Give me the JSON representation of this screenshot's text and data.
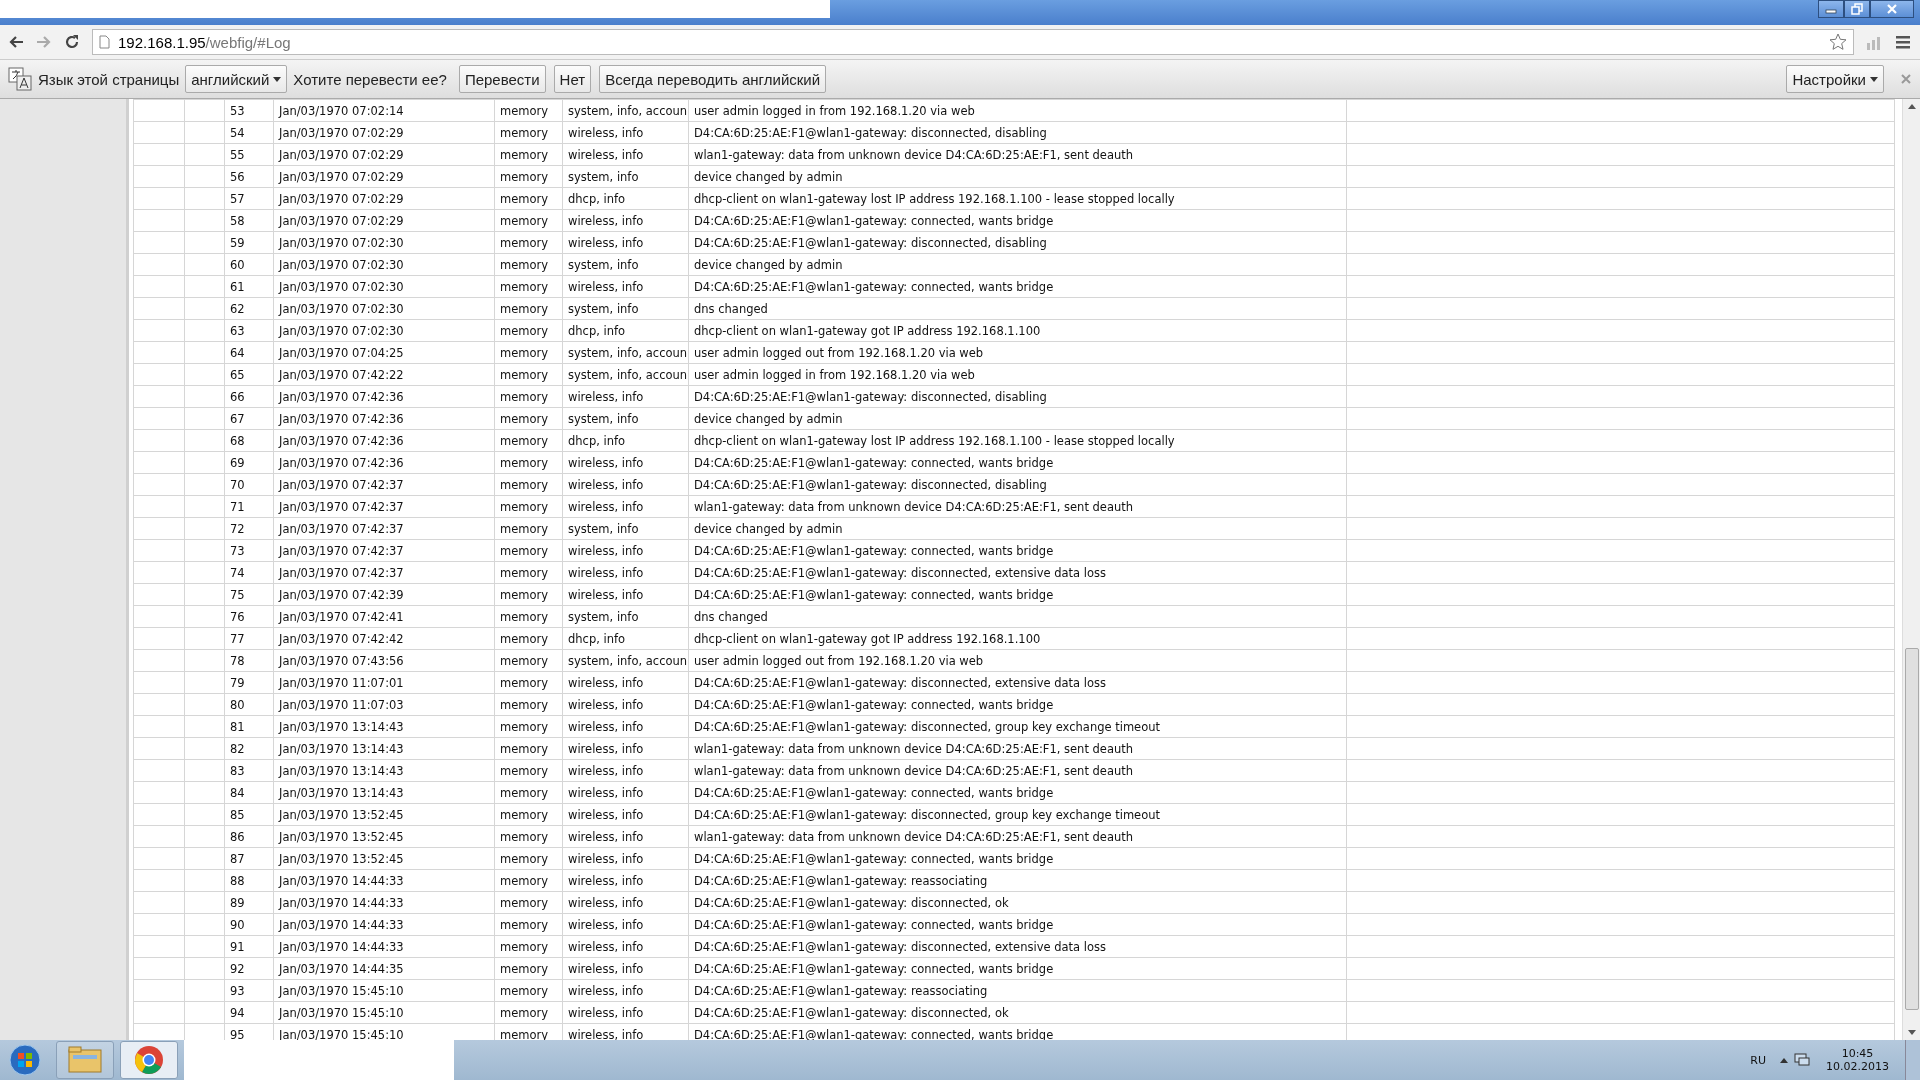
{
  "address_bar": {
    "host": "192.168.1.95",
    "path": "/webfig/#Log"
  },
  "translate_bar": {
    "label": "Язык этой страницы",
    "language": "английский",
    "question": "Хотите перевести ее?",
    "buttons": [
      "Перевести",
      "Нет",
      "Всегда переводить английский"
    ],
    "settings": "Настройки"
  },
  "log": {
    "rows": [
      {
        "number": "53",
        "time": "Jan/03/1970 07:02:14",
        "buffer": "memory",
        "topics": "system, info, accoun",
        "message": "user admin logged in from 192.168.1.20 via web"
      },
      {
        "number": "54",
        "time": "Jan/03/1970 07:02:29",
        "buffer": "memory",
        "topics": "wireless, info",
        "message": "D4:CA:6D:25:AE:F1@wlan1-gateway: disconnected, disabling"
      },
      {
        "number": "55",
        "time": "Jan/03/1970 07:02:29",
        "buffer": "memory",
        "topics": "wireless, info",
        "message": "wlan1-gateway: data from unknown device D4:CA:6D:25:AE:F1, sent deauth"
      },
      {
        "number": "56",
        "time": "Jan/03/1970 07:02:29",
        "buffer": "memory",
        "topics": "system, info",
        "message": "device changed by admin"
      },
      {
        "number": "57",
        "time": "Jan/03/1970 07:02:29",
        "buffer": "memory",
        "topics": "dhcp, info",
        "message": "dhcp-client on wlan1-gateway lost IP address 192.168.1.100 - lease stopped locally"
      },
      {
        "number": "58",
        "time": "Jan/03/1970 07:02:29",
        "buffer": "memory",
        "topics": "wireless, info",
        "message": "D4:CA:6D:25:AE:F1@wlan1-gateway: connected, wants bridge"
      },
      {
        "number": "59",
        "time": "Jan/03/1970 07:02:30",
        "buffer": "memory",
        "topics": "wireless, info",
        "message": "D4:CA:6D:25:AE:F1@wlan1-gateway: disconnected, disabling"
      },
      {
        "number": "60",
        "time": "Jan/03/1970 07:02:30",
        "buffer": "memory",
        "topics": "system, info",
        "message": "device changed by admin"
      },
      {
        "number": "61",
        "time": "Jan/03/1970 07:02:30",
        "buffer": "memory",
        "topics": "wireless, info",
        "message": "D4:CA:6D:25:AE:F1@wlan1-gateway: connected, wants bridge"
      },
      {
        "number": "62",
        "time": "Jan/03/1970 07:02:30",
        "buffer": "memory",
        "topics": "system, info",
        "message": "dns changed"
      },
      {
        "number": "63",
        "time": "Jan/03/1970 07:02:30",
        "buffer": "memory",
        "topics": "dhcp, info",
        "message": "dhcp-client on wlan1-gateway got IP address 192.168.1.100"
      },
      {
        "number": "64",
        "time": "Jan/03/1970 07:04:25",
        "buffer": "memory",
        "topics": "system, info, accoun",
        "message": "user admin logged out from 192.168.1.20 via web"
      },
      {
        "number": "65",
        "time": "Jan/03/1970 07:42:22",
        "buffer": "memory",
        "topics": "system, info, accoun",
        "message": "user admin logged in from 192.168.1.20 via web"
      },
      {
        "number": "66",
        "time": "Jan/03/1970 07:42:36",
        "buffer": "memory",
        "topics": "wireless, info",
        "message": "D4:CA:6D:25:AE:F1@wlan1-gateway: disconnected, disabling"
      },
      {
        "number": "67",
        "time": "Jan/03/1970 07:42:36",
        "buffer": "memory",
        "topics": "system, info",
        "message": "device changed by admin"
      },
      {
        "number": "68",
        "time": "Jan/03/1970 07:42:36",
        "buffer": "memory",
        "topics": "dhcp, info",
        "message": "dhcp-client on wlan1-gateway lost IP address 192.168.1.100 - lease stopped locally"
      },
      {
        "number": "69",
        "time": "Jan/03/1970 07:42:36",
        "buffer": "memory",
        "topics": "wireless, info",
        "message": "D4:CA:6D:25:AE:F1@wlan1-gateway: connected, wants bridge"
      },
      {
        "number": "70",
        "time": "Jan/03/1970 07:42:37",
        "buffer": "memory",
        "topics": "wireless, info",
        "message": "D4:CA:6D:25:AE:F1@wlan1-gateway: disconnected, disabling"
      },
      {
        "number": "71",
        "time": "Jan/03/1970 07:42:37",
        "buffer": "memory",
        "topics": "wireless, info",
        "message": "wlan1-gateway: data from unknown device D4:CA:6D:25:AE:F1, sent deauth"
      },
      {
        "number": "72",
        "time": "Jan/03/1970 07:42:37",
        "buffer": "memory",
        "topics": "system, info",
        "message": "device changed by admin"
      },
      {
        "number": "73",
        "time": "Jan/03/1970 07:42:37",
        "buffer": "memory",
        "topics": "wireless, info",
        "message": "D4:CA:6D:25:AE:F1@wlan1-gateway: connected, wants bridge"
      },
      {
        "number": "74",
        "time": "Jan/03/1970 07:42:37",
        "buffer": "memory",
        "topics": "wireless, info",
        "message": "D4:CA:6D:25:AE:F1@wlan1-gateway: disconnected, extensive data loss"
      },
      {
        "number": "75",
        "time": "Jan/03/1970 07:42:39",
        "buffer": "memory",
        "topics": "wireless, info",
        "message": "D4:CA:6D:25:AE:F1@wlan1-gateway: connected, wants bridge"
      },
      {
        "number": "76",
        "time": "Jan/03/1970 07:42:41",
        "buffer": "memory",
        "topics": "system, info",
        "message": "dns changed"
      },
      {
        "number": "77",
        "time": "Jan/03/1970 07:42:42",
        "buffer": "memory",
        "topics": "dhcp, info",
        "message": "dhcp-client on wlan1-gateway got IP address 192.168.1.100"
      },
      {
        "number": "78",
        "time": "Jan/03/1970 07:43:56",
        "buffer": "memory",
        "topics": "system, info, accoun",
        "message": "user admin logged out from 192.168.1.20 via web"
      },
      {
        "number": "79",
        "time": "Jan/03/1970 11:07:01",
        "buffer": "memory",
        "topics": "wireless, info",
        "message": "D4:CA:6D:25:AE:F1@wlan1-gateway: disconnected, extensive data loss"
      },
      {
        "number": "80",
        "time": "Jan/03/1970 11:07:03",
        "buffer": "memory",
        "topics": "wireless, info",
        "message": "D4:CA:6D:25:AE:F1@wlan1-gateway: connected, wants bridge"
      },
      {
        "number": "81",
        "time": "Jan/03/1970 13:14:43",
        "buffer": "memory",
        "topics": "wireless, info",
        "message": "D4:CA:6D:25:AE:F1@wlan1-gateway: disconnected, group key exchange timeout"
      },
      {
        "number": "82",
        "time": "Jan/03/1970 13:14:43",
        "buffer": "memory",
        "topics": "wireless, info",
        "message": "wlan1-gateway: data from unknown device D4:CA:6D:25:AE:F1, sent deauth"
      },
      {
        "number": "83",
        "time": "Jan/03/1970 13:14:43",
        "buffer": "memory",
        "topics": "wireless, info",
        "message": "wlan1-gateway: data from unknown device D4:CA:6D:25:AE:F1, sent deauth"
      },
      {
        "number": "84",
        "time": "Jan/03/1970 13:14:43",
        "buffer": "memory",
        "topics": "wireless, info",
        "message": "D4:CA:6D:25:AE:F1@wlan1-gateway: connected, wants bridge"
      },
      {
        "number": "85",
        "time": "Jan/03/1970 13:52:45",
        "buffer": "memory",
        "topics": "wireless, info",
        "message": "D4:CA:6D:25:AE:F1@wlan1-gateway: disconnected, group key exchange timeout"
      },
      {
        "number": "86",
        "time": "Jan/03/1970 13:52:45",
        "buffer": "memory",
        "topics": "wireless, info",
        "message": "wlan1-gateway: data from unknown device D4:CA:6D:25:AE:F1, sent deauth"
      },
      {
        "number": "87",
        "time": "Jan/03/1970 13:52:45",
        "buffer": "memory",
        "topics": "wireless, info",
        "message": "D4:CA:6D:25:AE:F1@wlan1-gateway: connected, wants bridge"
      },
      {
        "number": "88",
        "time": "Jan/03/1970 14:44:33",
        "buffer": "memory",
        "topics": "wireless, info",
        "message": "D4:CA:6D:25:AE:F1@wlan1-gateway: reassociating"
      },
      {
        "number": "89",
        "time": "Jan/03/1970 14:44:33",
        "buffer": "memory",
        "topics": "wireless, info",
        "message": "D4:CA:6D:25:AE:F1@wlan1-gateway: disconnected, ok"
      },
      {
        "number": "90",
        "time": "Jan/03/1970 14:44:33",
        "buffer": "memory",
        "topics": "wireless, info",
        "message": "D4:CA:6D:25:AE:F1@wlan1-gateway: connected, wants bridge"
      },
      {
        "number": "91",
        "time": "Jan/03/1970 14:44:33",
        "buffer": "memory",
        "topics": "wireless, info",
        "message": "D4:CA:6D:25:AE:F1@wlan1-gateway: disconnected, extensive data loss"
      },
      {
        "number": "92",
        "time": "Jan/03/1970 14:44:35",
        "buffer": "memory",
        "topics": "wireless, info",
        "message": "D4:CA:6D:25:AE:F1@wlan1-gateway: connected, wants bridge"
      },
      {
        "number": "93",
        "time": "Jan/03/1970 15:45:10",
        "buffer": "memory",
        "topics": "wireless, info",
        "message": "D4:CA:6D:25:AE:F1@wlan1-gateway: reassociating"
      },
      {
        "number": "94",
        "time": "Jan/03/1970 15:45:10",
        "buffer": "memory",
        "topics": "wireless, info",
        "message": "D4:CA:6D:25:AE:F1@wlan1-gateway: disconnected, ok"
      },
      {
        "number": "95",
        "time": "Jan/03/1970 15:45:10",
        "buffer": "memory",
        "topics": "wireless, info",
        "message": "D4:CA:6D:25:AE:F1@wlan1-gateway: connected, wants bridge"
      }
    ]
  },
  "taskbar": {
    "language": "RU",
    "time": "10:45",
    "date": "10.02.2013"
  }
}
